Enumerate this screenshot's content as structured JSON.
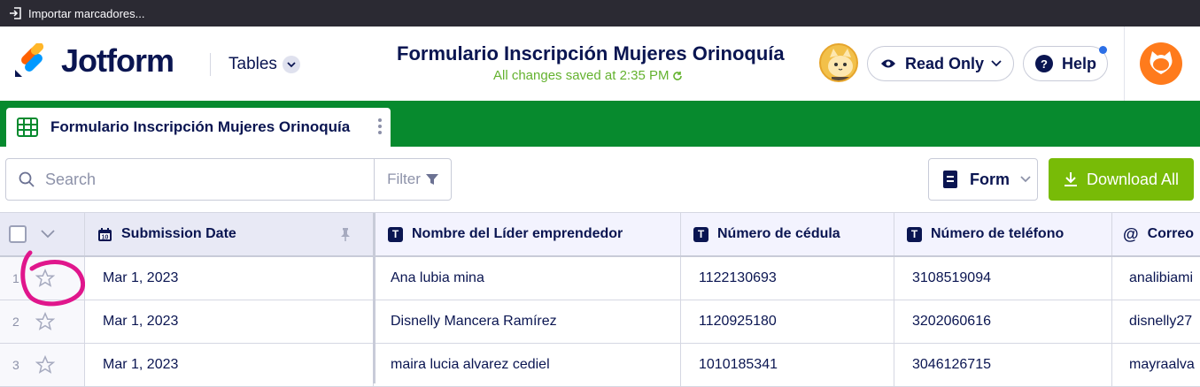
{
  "browser": {
    "bookmark_label": "Importar marcadores..."
  },
  "header": {
    "logo_text": "Jotform",
    "tables_label": "Tables",
    "form_title": "Formulario Inscripción Mujeres Orinoquía",
    "save_status": "All changes saved at 2:35 PM",
    "read_only_label": "Read Only",
    "help_label": "Help"
  },
  "tab": {
    "label": "Formulario Inscripción Mujeres Orinoquía"
  },
  "toolbar": {
    "search_placeholder": "Search",
    "filter_label": "Filter",
    "form_label": "Form",
    "download_label": "Download All"
  },
  "table": {
    "columns": [
      {
        "label": "Submission Date",
        "type_icon": "calendar-icon"
      },
      {
        "label": "Nombre del Líder emprendedor",
        "type_icon": "text-type-icon"
      },
      {
        "label": "Número de cédula",
        "type_icon": "text-type-icon"
      },
      {
        "label": "Número de teléfono",
        "type_icon": "text-type-icon"
      },
      {
        "label": "Correo",
        "type_icon": "at-icon"
      }
    ],
    "rows": [
      {
        "num": "1",
        "date": "Mar 1, 2023",
        "name": "Ana lubia mina",
        "cedula": "1122130693",
        "telefono": "3108519094",
        "correo": "analibiami"
      },
      {
        "num": "2",
        "date": "Mar 1, 2023",
        "name": "Disnelly Mancera Ramírez",
        "cedula": "1120925180",
        "telefono": "3202060616",
        "correo": "disnelly27"
      },
      {
        "num": "3",
        "date": "Mar 1, 2023",
        "name": "maira lucia alvarez cediel",
        "cedula": "1010185341",
        "telefono": "3046126715",
        "correo": "mayraalva"
      }
    ]
  },
  "colors": {
    "brand_navy": "#0a1551",
    "tab_green": "#078a2e",
    "download_green": "#78bb07",
    "save_green": "#64b22f",
    "annotation_magenta": "#e0168c"
  }
}
